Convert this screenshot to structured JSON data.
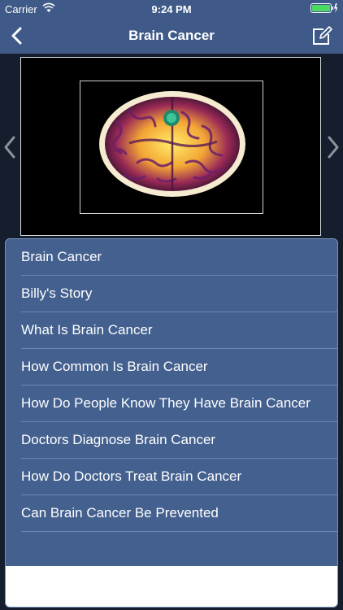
{
  "status_bar": {
    "carrier": "Carrier",
    "time": "9:24 PM"
  },
  "nav": {
    "title": "Brain Cancer"
  },
  "topics": [
    "Brain Cancer",
    "Billy's Story",
    "What Is Brain Cancer",
    "How Common Is Brain Cancer",
    "How Do People Know They Have Brain Cancer",
    "Doctors Diagnose Brain Cancer",
    "How Do Doctors Treat Brain Cancer",
    "Can Brain Cancer Be Prevented"
  ],
  "colors": {
    "accent": "#3f5a88",
    "list_bg": "#43608f",
    "divider": "#6f86ad"
  }
}
